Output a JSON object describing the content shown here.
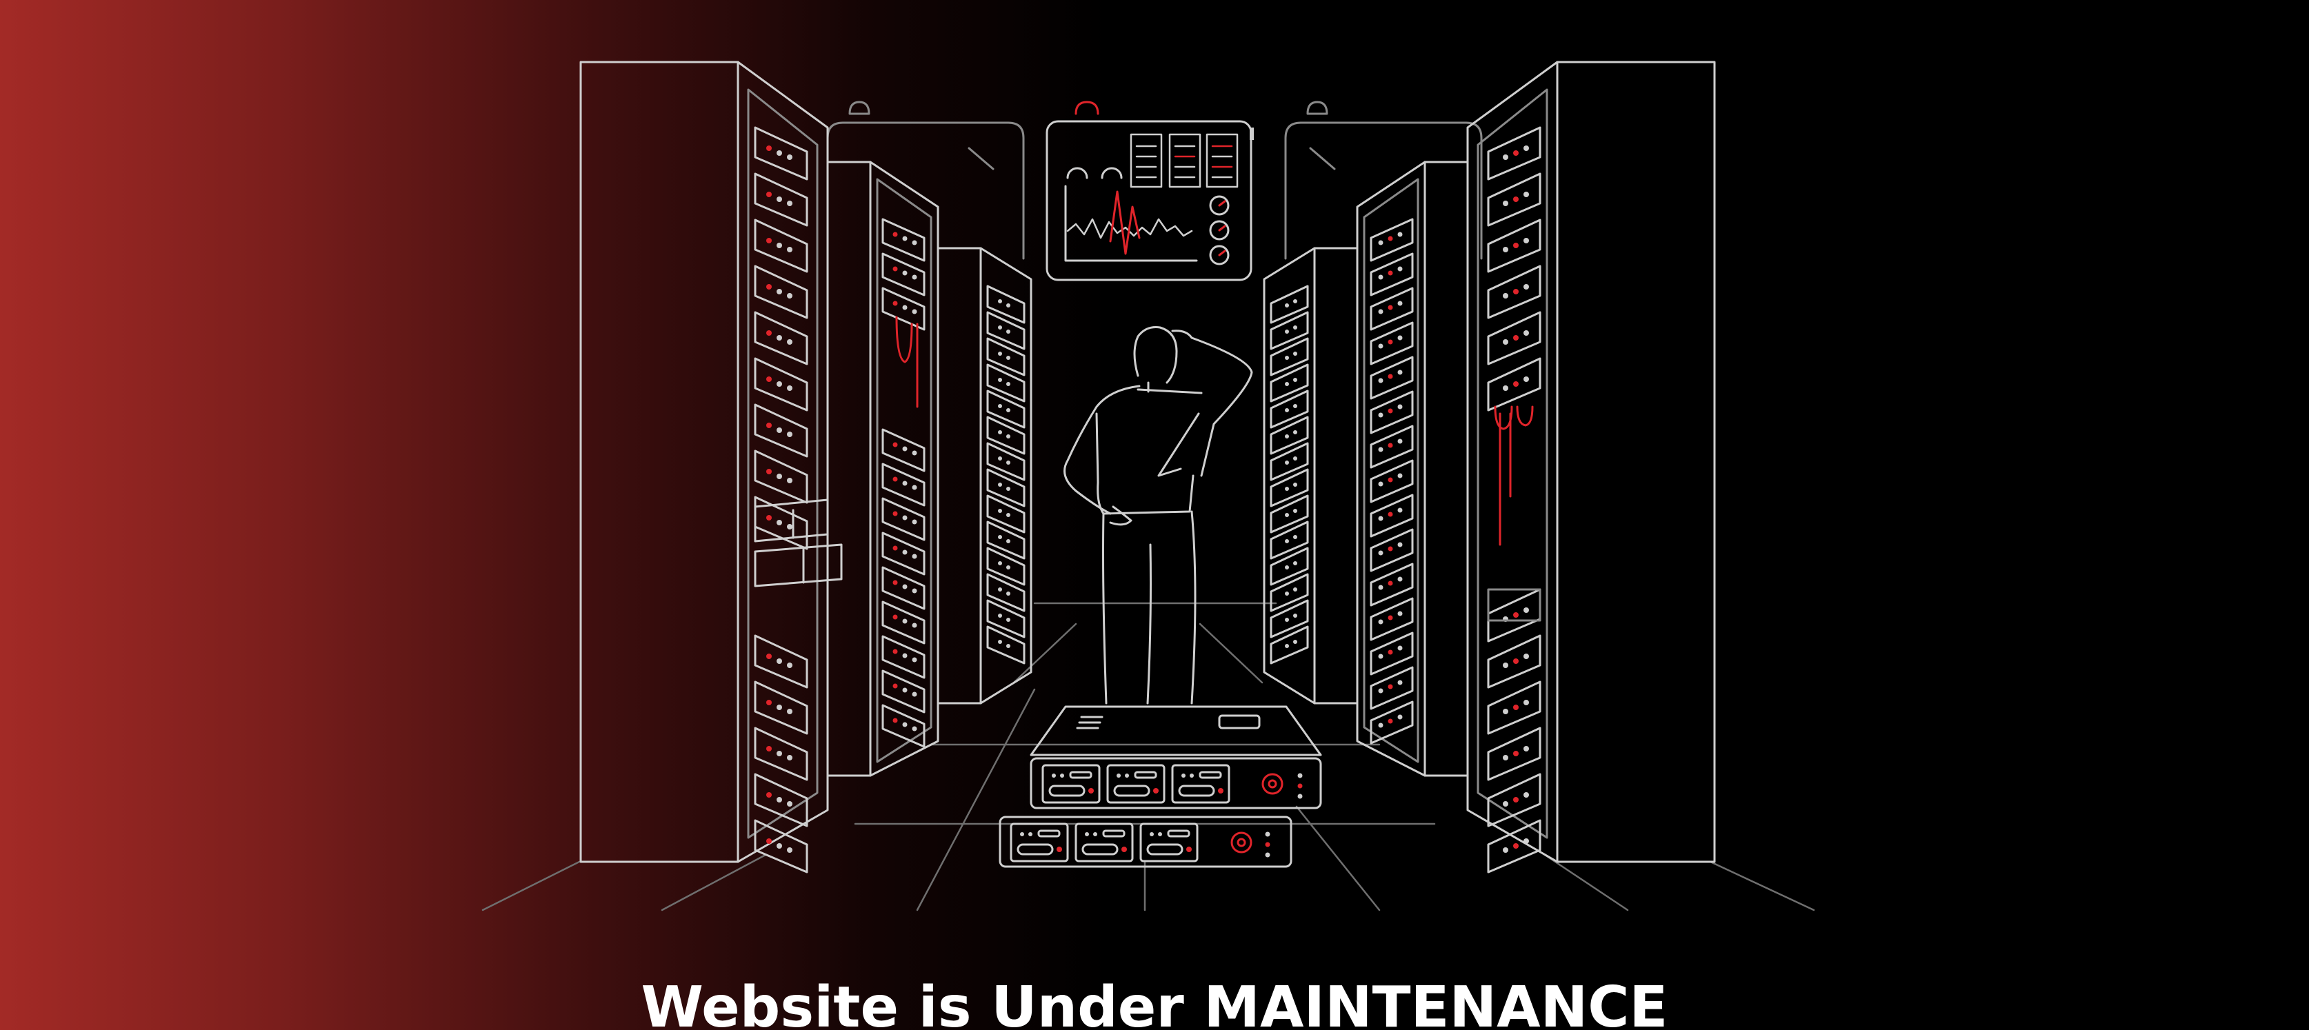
{
  "headline": {
    "text": "Website is Under MAINTENANCE"
  },
  "illustration": {
    "icon": "server-room-maintenance-illustration",
    "line_color": "#cfcfcf",
    "accent_color": "#e0242a"
  },
  "colors": {
    "gradient_start": "#a32a26",
    "background": "#000000",
    "text": "#ffffff"
  }
}
